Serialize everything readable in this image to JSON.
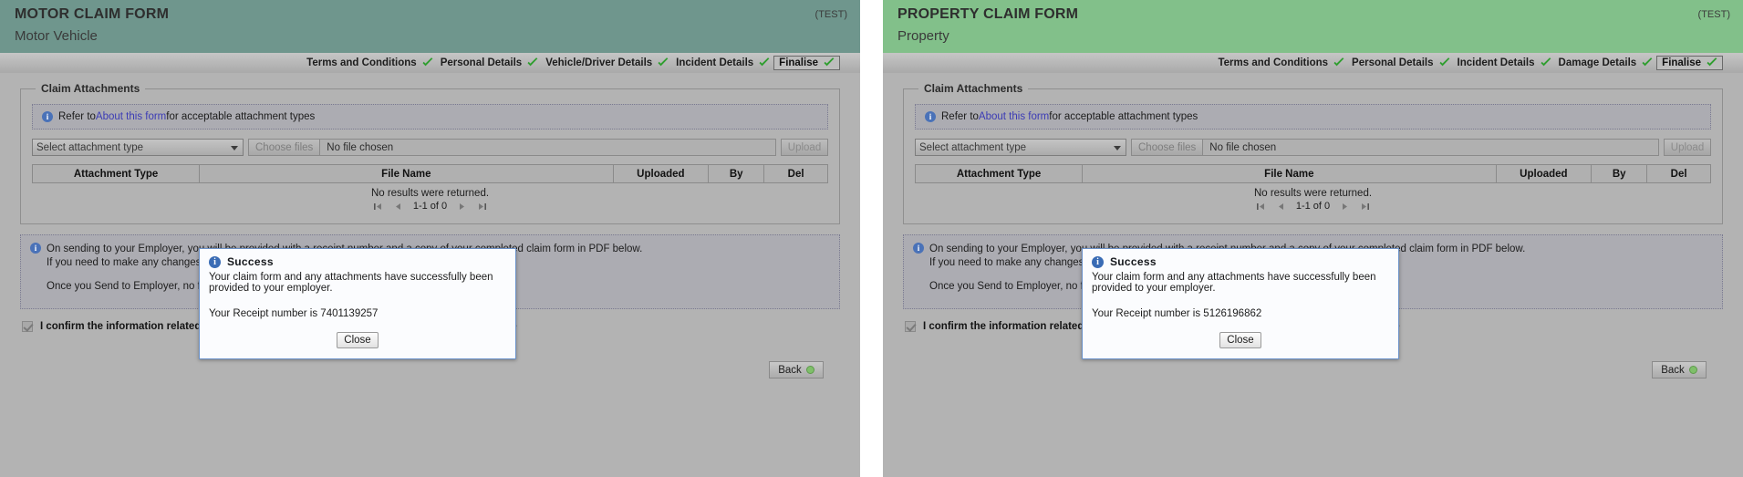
{
  "panels": [
    {
      "header": {
        "title": "MOTOR CLAIM FORM",
        "subtitle": "Motor Vehicle",
        "test_label": "(TEST)",
        "bg_color": "#6f968d"
      },
      "steps": [
        {
          "label": "Terms and Conditions",
          "done": true,
          "current": false
        },
        {
          "label": "Personal Details",
          "done": true,
          "current": false
        },
        {
          "label": "Vehicle/Driver Details",
          "done": true,
          "current": false
        },
        {
          "label": "Incident Details",
          "done": true,
          "current": false
        },
        {
          "label": "Finalise",
          "done": true,
          "current": true
        }
      ],
      "attachments": {
        "legend": "Claim Attachments",
        "note_prefix": "Refer to ",
        "note_link": "About this form",
        "note_suffix": " for acceptable attachment types",
        "select_value": "Select attachment type",
        "choose_files_label": "Choose files",
        "file_status": "No file chosen",
        "upload_label": "Upload",
        "columns": [
          "Attachment Type",
          "File Name",
          "Uploaded",
          "By",
          "Del"
        ],
        "empty_text": "No results were returned.",
        "page_info": "1-1 of 0"
      },
      "info": {
        "line1": "On sending to your Employer, you will be provided with a receipt number and a copy of your completed claim form in PDF below.",
        "line2": "If you need to make any changes, you may do so by returning to the relevant section.",
        "line3": "Once you Send to Employer, no further changes can be made."
      },
      "confirm": {
        "label": "I confirm the information related to this incident is true and correct to the best of my knowledge",
        "checked": true
      },
      "back_label": "Back",
      "modal": {
        "title": "Success",
        "message": "Your claim form and any attachments have successfully been provided to your employer.",
        "receipt": "Your Receipt number is 7401139257",
        "close_label": "Close"
      }
    },
    {
      "header": {
        "title": "PROPERTY CLAIM FORM",
        "subtitle": "Property",
        "test_label": "(TEST)",
        "bg_color": "#82c08a"
      },
      "steps": [
        {
          "label": "Terms and Conditions",
          "done": true,
          "current": false
        },
        {
          "label": "Personal Details",
          "done": true,
          "current": false
        },
        {
          "label": "Incident Details",
          "done": true,
          "current": false
        },
        {
          "label": "Damage Details",
          "done": true,
          "current": false
        },
        {
          "label": "Finalise",
          "done": true,
          "current": true
        }
      ],
      "attachments": {
        "legend": "Claim Attachments",
        "note_prefix": "Refer to ",
        "note_link": "About this form",
        "note_suffix": " for acceptable attachment types",
        "select_value": "Select attachment type",
        "choose_files_label": "Choose files",
        "file_status": "No file chosen",
        "upload_label": "Upload",
        "columns": [
          "Attachment Type",
          "File Name",
          "Uploaded",
          "By",
          "Del"
        ],
        "empty_text": "No results were returned.",
        "page_info": "1-1 of 0"
      },
      "info": {
        "line1": "On sending to your Employer, you will be provided with a receipt number and a copy of your completed claim form in PDF below.",
        "line2": "If you need to make any changes, you may do so by returning to the relevant section.",
        "line3": "Once you Send to Employer, no further changes can be made."
      },
      "confirm": {
        "label": "I confirm the information related to this incident is true and correct to the best of my knowledge",
        "checked": true
      },
      "back_label": "Back",
      "modal": {
        "title": "Success",
        "message": "Your claim form and any attachments have successfully been provided to your employer.",
        "receipt": "Your Receipt number is 5126196862",
        "close_label": "Close"
      }
    }
  ]
}
